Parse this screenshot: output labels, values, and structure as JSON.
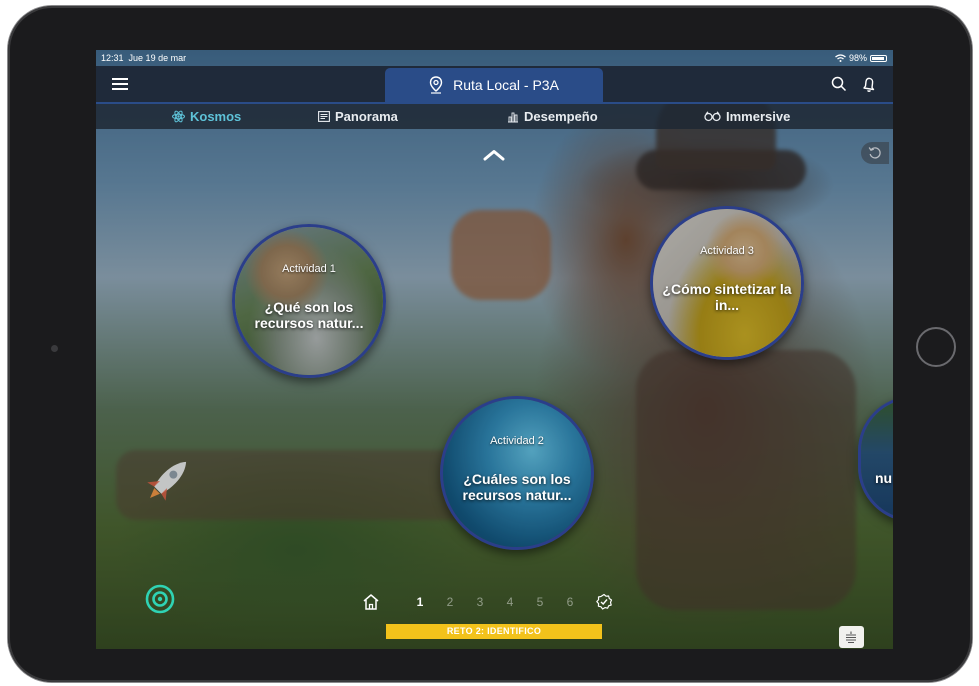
{
  "statusbar": {
    "time": "12:31",
    "date": "Jue 19 de mar",
    "battery": "98%"
  },
  "header": {
    "title": "Ruta Local - P3A",
    "location_icon": "location-pin-icon",
    "menu_icon": "hamburger-menu-icon",
    "search_icon": "search-icon",
    "notification_icon": "bell-icon"
  },
  "tabs": [
    {
      "label": "Kosmos",
      "icon": "atom-icon",
      "active": true
    },
    {
      "label": "Panorama",
      "icon": "newspaper-icon",
      "active": false
    },
    {
      "label": "Desempeño",
      "icon": "bar-chart-icon",
      "active": false
    },
    {
      "label": "Immersive",
      "icon": "vr-goggles-icon",
      "active": false
    }
  ],
  "activities": [
    {
      "label": "Actividad 1",
      "question": "¿Qué son los recursos natur..."
    },
    {
      "label": "Actividad 2",
      "question": "¿Cuáles son los recursos natur..."
    },
    {
      "label": "Actividad 3",
      "question": "¿Cómo sintetizar la in..."
    },
    {
      "label": "",
      "question": "nu"
    }
  ],
  "pager": {
    "pages": [
      "1",
      "2",
      "3",
      "4",
      "5",
      "6"
    ],
    "current": "1"
  },
  "reto": {
    "label": "RETO 2: IDENTIFICO"
  },
  "colors": {
    "accent": "#5ec2d8",
    "header_bg": "#1f2a3a",
    "title_tab": "#2a4c88",
    "circle_border": "#2b3e8a",
    "reto_bar": "#f2c21b"
  }
}
